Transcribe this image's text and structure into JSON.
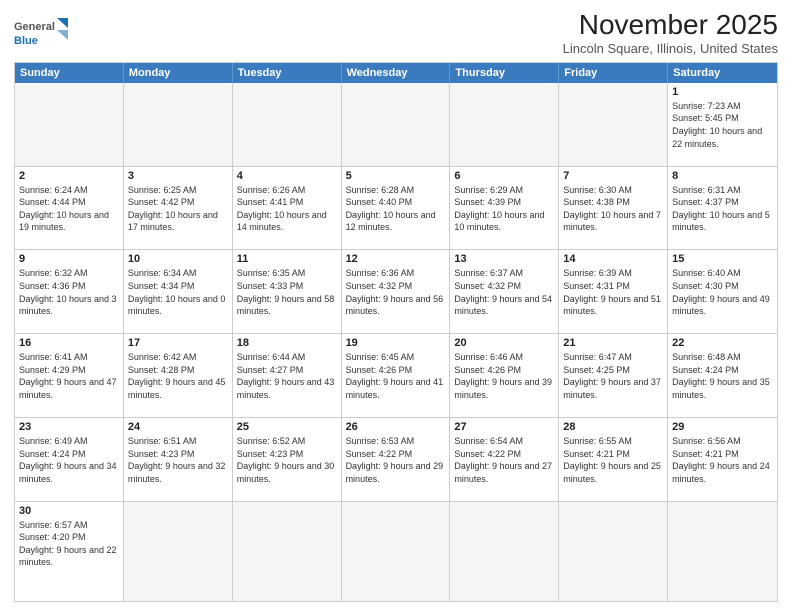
{
  "header": {
    "logo_general": "General",
    "logo_blue": "Blue",
    "month_title": "November 2025",
    "location": "Lincoln Square, Illinois, United States"
  },
  "days_of_week": [
    "Sunday",
    "Monday",
    "Tuesday",
    "Wednesday",
    "Thursday",
    "Friday",
    "Saturday"
  ],
  "rows": [
    [
      {
        "day": "",
        "info": ""
      },
      {
        "day": "",
        "info": ""
      },
      {
        "day": "",
        "info": ""
      },
      {
        "day": "",
        "info": ""
      },
      {
        "day": "",
        "info": ""
      },
      {
        "day": "",
        "info": ""
      },
      {
        "day": "1",
        "info": "Sunrise: 7:23 AM\nSunset: 5:45 PM\nDaylight: 10 hours and 22 minutes."
      }
    ],
    [
      {
        "day": "2",
        "info": "Sunrise: 6:24 AM\nSunset: 4:44 PM\nDaylight: 10 hours and 19 minutes."
      },
      {
        "day": "3",
        "info": "Sunrise: 6:25 AM\nSunset: 4:42 PM\nDaylight: 10 hours and 17 minutes."
      },
      {
        "day": "4",
        "info": "Sunrise: 6:26 AM\nSunset: 4:41 PM\nDaylight: 10 hours and 14 minutes."
      },
      {
        "day": "5",
        "info": "Sunrise: 6:28 AM\nSunset: 4:40 PM\nDaylight: 10 hours and 12 minutes."
      },
      {
        "day": "6",
        "info": "Sunrise: 6:29 AM\nSunset: 4:39 PM\nDaylight: 10 hours and 10 minutes."
      },
      {
        "day": "7",
        "info": "Sunrise: 6:30 AM\nSunset: 4:38 PM\nDaylight: 10 hours and 7 minutes."
      },
      {
        "day": "8",
        "info": "Sunrise: 6:31 AM\nSunset: 4:37 PM\nDaylight: 10 hours and 5 minutes."
      }
    ],
    [
      {
        "day": "9",
        "info": "Sunrise: 6:32 AM\nSunset: 4:36 PM\nDaylight: 10 hours and 3 minutes."
      },
      {
        "day": "10",
        "info": "Sunrise: 6:34 AM\nSunset: 4:34 PM\nDaylight: 10 hours and 0 minutes."
      },
      {
        "day": "11",
        "info": "Sunrise: 6:35 AM\nSunset: 4:33 PM\nDaylight: 9 hours and 58 minutes."
      },
      {
        "day": "12",
        "info": "Sunrise: 6:36 AM\nSunset: 4:32 PM\nDaylight: 9 hours and 56 minutes."
      },
      {
        "day": "13",
        "info": "Sunrise: 6:37 AM\nSunset: 4:32 PM\nDaylight: 9 hours and 54 minutes."
      },
      {
        "day": "14",
        "info": "Sunrise: 6:39 AM\nSunset: 4:31 PM\nDaylight: 9 hours and 51 minutes."
      },
      {
        "day": "15",
        "info": "Sunrise: 6:40 AM\nSunset: 4:30 PM\nDaylight: 9 hours and 49 minutes."
      }
    ],
    [
      {
        "day": "16",
        "info": "Sunrise: 6:41 AM\nSunset: 4:29 PM\nDaylight: 9 hours and 47 minutes."
      },
      {
        "day": "17",
        "info": "Sunrise: 6:42 AM\nSunset: 4:28 PM\nDaylight: 9 hours and 45 minutes."
      },
      {
        "day": "18",
        "info": "Sunrise: 6:44 AM\nSunset: 4:27 PM\nDaylight: 9 hours and 43 minutes."
      },
      {
        "day": "19",
        "info": "Sunrise: 6:45 AM\nSunset: 4:26 PM\nDaylight: 9 hours and 41 minutes."
      },
      {
        "day": "20",
        "info": "Sunrise: 6:46 AM\nSunset: 4:26 PM\nDaylight: 9 hours and 39 minutes."
      },
      {
        "day": "21",
        "info": "Sunrise: 6:47 AM\nSunset: 4:25 PM\nDaylight: 9 hours and 37 minutes."
      },
      {
        "day": "22",
        "info": "Sunrise: 6:48 AM\nSunset: 4:24 PM\nDaylight: 9 hours and 35 minutes."
      }
    ],
    [
      {
        "day": "23",
        "info": "Sunrise: 6:49 AM\nSunset: 4:24 PM\nDaylight: 9 hours and 34 minutes."
      },
      {
        "day": "24",
        "info": "Sunrise: 6:51 AM\nSunset: 4:23 PM\nDaylight: 9 hours and 32 minutes."
      },
      {
        "day": "25",
        "info": "Sunrise: 6:52 AM\nSunset: 4:23 PM\nDaylight: 9 hours and 30 minutes."
      },
      {
        "day": "26",
        "info": "Sunrise: 6:53 AM\nSunset: 4:22 PM\nDaylight: 9 hours and 29 minutes."
      },
      {
        "day": "27",
        "info": "Sunrise: 6:54 AM\nSunset: 4:22 PM\nDaylight: 9 hours and 27 minutes."
      },
      {
        "day": "28",
        "info": "Sunrise: 6:55 AM\nSunset: 4:21 PM\nDaylight: 9 hours and 25 minutes."
      },
      {
        "day": "29",
        "info": "Sunrise: 6:56 AM\nSunset: 4:21 PM\nDaylight: 9 hours and 24 minutes."
      }
    ],
    [
      {
        "day": "30",
        "info": "Sunrise: 6:57 AM\nSunset: 4:20 PM\nDaylight: 9 hours and 22 minutes."
      },
      {
        "day": "",
        "info": ""
      },
      {
        "day": "",
        "info": ""
      },
      {
        "day": "",
        "info": ""
      },
      {
        "day": "",
        "info": ""
      },
      {
        "day": "",
        "info": ""
      },
      {
        "day": "",
        "info": ""
      }
    ]
  ]
}
